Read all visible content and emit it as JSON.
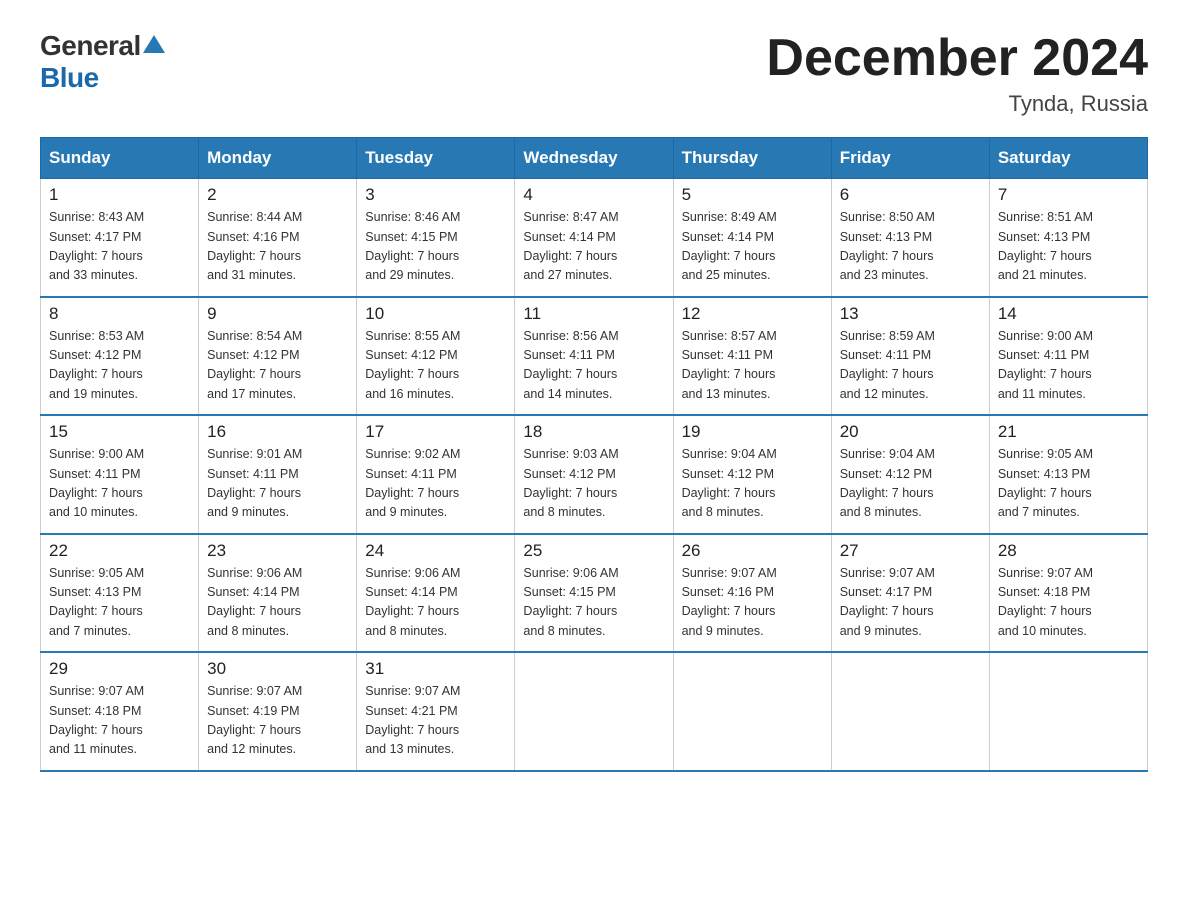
{
  "logo": {
    "general": "General",
    "blue": "Blue"
  },
  "title": "December 2024",
  "location": "Tynda, Russia",
  "days_of_week": [
    "Sunday",
    "Monday",
    "Tuesday",
    "Wednesday",
    "Thursday",
    "Friday",
    "Saturday"
  ],
  "weeks": [
    [
      {
        "day": "1",
        "sunrise": "8:43 AM",
        "sunset": "4:17 PM",
        "daylight": "7 hours and 33 minutes."
      },
      {
        "day": "2",
        "sunrise": "8:44 AM",
        "sunset": "4:16 PM",
        "daylight": "7 hours and 31 minutes."
      },
      {
        "day": "3",
        "sunrise": "8:46 AM",
        "sunset": "4:15 PM",
        "daylight": "7 hours and 29 minutes."
      },
      {
        "day": "4",
        "sunrise": "8:47 AM",
        "sunset": "4:14 PM",
        "daylight": "7 hours and 27 minutes."
      },
      {
        "day": "5",
        "sunrise": "8:49 AM",
        "sunset": "4:14 PM",
        "daylight": "7 hours and 25 minutes."
      },
      {
        "day": "6",
        "sunrise": "8:50 AM",
        "sunset": "4:13 PM",
        "daylight": "7 hours and 23 minutes."
      },
      {
        "day": "7",
        "sunrise": "8:51 AM",
        "sunset": "4:13 PM",
        "daylight": "7 hours and 21 minutes."
      }
    ],
    [
      {
        "day": "8",
        "sunrise": "8:53 AM",
        "sunset": "4:12 PM",
        "daylight": "7 hours and 19 minutes."
      },
      {
        "day": "9",
        "sunrise": "8:54 AM",
        "sunset": "4:12 PM",
        "daylight": "7 hours and 17 minutes."
      },
      {
        "day": "10",
        "sunrise": "8:55 AM",
        "sunset": "4:12 PM",
        "daylight": "7 hours and 16 minutes."
      },
      {
        "day": "11",
        "sunrise": "8:56 AM",
        "sunset": "4:11 PM",
        "daylight": "7 hours and 14 minutes."
      },
      {
        "day": "12",
        "sunrise": "8:57 AM",
        "sunset": "4:11 PM",
        "daylight": "7 hours and 13 minutes."
      },
      {
        "day": "13",
        "sunrise": "8:59 AM",
        "sunset": "4:11 PM",
        "daylight": "7 hours and 12 minutes."
      },
      {
        "day": "14",
        "sunrise": "9:00 AM",
        "sunset": "4:11 PM",
        "daylight": "7 hours and 11 minutes."
      }
    ],
    [
      {
        "day": "15",
        "sunrise": "9:00 AM",
        "sunset": "4:11 PM",
        "daylight": "7 hours and 10 minutes."
      },
      {
        "day": "16",
        "sunrise": "9:01 AM",
        "sunset": "4:11 PM",
        "daylight": "7 hours and 9 minutes."
      },
      {
        "day": "17",
        "sunrise": "9:02 AM",
        "sunset": "4:11 PM",
        "daylight": "7 hours and 9 minutes."
      },
      {
        "day": "18",
        "sunrise": "9:03 AM",
        "sunset": "4:12 PM",
        "daylight": "7 hours and 8 minutes."
      },
      {
        "day": "19",
        "sunrise": "9:04 AM",
        "sunset": "4:12 PM",
        "daylight": "7 hours and 8 minutes."
      },
      {
        "day": "20",
        "sunrise": "9:04 AM",
        "sunset": "4:12 PM",
        "daylight": "7 hours and 8 minutes."
      },
      {
        "day": "21",
        "sunrise": "9:05 AM",
        "sunset": "4:13 PM",
        "daylight": "7 hours and 7 minutes."
      }
    ],
    [
      {
        "day": "22",
        "sunrise": "9:05 AM",
        "sunset": "4:13 PM",
        "daylight": "7 hours and 7 minutes."
      },
      {
        "day": "23",
        "sunrise": "9:06 AM",
        "sunset": "4:14 PM",
        "daylight": "7 hours and 8 minutes."
      },
      {
        "day": "24",
        "sunrise": "9:06 AM",
        "sunset": "4:14 PM",
        "daylight": "7 hours and 8 minutes."
      },
      {
        "day": "25",
        "sunrise": "9:06 AM",
        "sunset": "4:15 PM",
        "daylight": "7 hours and 8 minutes."
      },
      {
        "day": "26",
        "sunrise": "9:07 AM",
        "sunset": "4:16 PM",
        "daylight": "7 hours and 9 minutes."
      },
      {
        "day": "27",
        "sunrise": "9:07 AM",
        "sunset": "4:17 PM",
        "daylight": "7 hours and 9 minutes."
      },
      {
        "day": "28",
        "sunrise": "9:07 AM",
        "sunset": "4:18 PM",
        "daylight": "7 hours and 10 minutes."
      }
    ],
    [
      {
        "day": "29",
        "sunrise": "9:07 AM",
        "sunset": "4:18 PM",
        "daylight": "7 hours and 11 minutes."
      },
      {
        "day": "30",
        "sunrise": "9:07 AM",
        "sunset": "4:19 PM",
        "daylight": "7 hours and 12 minutes."
      },
      {
        "day": "31",
        "sunrise": "9:07 AM",
        "sunset": "4:21 PM",
        "daylight": "7 hours and 13 minutes."
      },
      null,
      null,
      null,
      null
    ]
  ],
  "labels": {
    "sunrise": "Sunrise:",
    "sunset": "Sunset:",
    "daylight": "Daylight:"
  }
}
